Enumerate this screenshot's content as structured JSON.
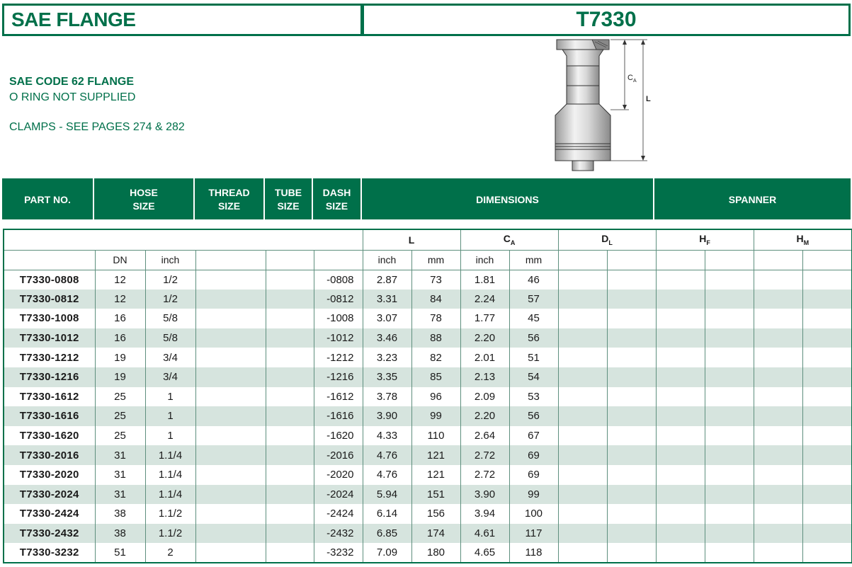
{
  "header": {
    "left_title": "SAE FLANGE",
    "right_title": "T7330"
  },
  "description": {
    "line1": "SAE CODE 62 FLANGE",
    "line2": "O RING NOT SUPPLIED",
    "line3": "CLAMPS - SEE PAGES 274 & 282"
  },
  "drawing": {
    "label_ca_main": "C",
    "label_ca_sub": "A",
    "label_l": "L"
  },
  "band": {
    "part_no": "PART NO.",
    "hose_size_1": "HOSE",
    "hose_size_2": "SIZE",
    "thread_size_1": "THREAD",
    "thread_size_2": "SIZE",
    "tube_size_1": "TUBE",
    "tube_size_2": "SIZE",
    "dash_size_1": "DASH",
    "dash_size_2": "SIZE",
    "dimensions": "DIMENSIONS",
    "spanner": "SPANNER"
  },
  "subheaders": {
    "l": "L",
    "ca_main": "C",
    "ca_sub": "A",
    "dl_main": "D",
    "dl_sub": "L",
    "hf_main": "H",
    "hf_sub": "F",
    "hm_main": "H",
    "hm_sub": "M",
    "dn": "DN",
    "inch": "inch",
    "mm": "mm"
  },
  "rows": [
    {
      "part": "T7330-0808",
      "dn": "12",
      "inch": "1/2",
      "dash": "-0808",
      "l_in": "2.87",
      "l_mm": "73",
      "ca_in": "1.81",
      "ca_mm": "46"
    },
    {
      "part": "T7330-0812",
      "dn": "12",
      "inch": "1/2",
      "dash": "-0812",
      "l_in": "3.31",
      "l_mm": "84",
      "ca_in": "2.24",
      "ca_mm": "57"
    },
    {
      "part": "T7330-1008",
      "dn": "16",
      "inch": "5/8",
      "dash": "-1008",
      "l_in": "3.07",
      "l_mm": "78",
      "ca_in": "1.77",
      "ca_mm": "45"
    },
    {
      "part": "T7330-1012",
      "dn": "16",
      "inch": "5/8",
      "dash": "-1012",
      "l_in": "3.46",
      "l_mm": "88",
      "ca_in": "2.20",
      "ca_mm": "56"
    },
    {
      "part": "T7330-1212",
      "dn": "19",
      "inch": "3/4",
      "dash": "-1212",
      "l_in": "3.23",
      "l_mm": "82",
      "ca_in": "2.01",
      "ca_mm": "51"
    },
    {
      "part": "T7330-1216",
      "dn": "19",
      "inch": "3/4",
      "dash": "-1216",
      "l_in": "3.35",
      "l_mm": "85",
      "ca_in": "2.13",
      "ca_mm": "54"
    },
    {
      "part": "T7330-1612",
      "dn": "25",
      "inch": "1",
      "dash": "-1612",
      "l_in": "3.78",
      "l_mm": "96",
      "ca_in": "2.09",
      "ca_mm": "53"
    },
    {
      "part": "T7330-1616",
      "dn": "25",
      "inch": "1",
      "dash": "-1616",
      "l_in": "3.90",
      "l_mm": "99",
      "ca_in": "2.20",
      "ca_mm": "56"
    },
    {
      "part": "T7330-1620",
      "dn": "25",
      "inch": "1",
      "dash": "-1620",
      "l_in": "4.33",
      "l_mm": "110",
      "ca_in": "2.64",
      "ca_mm": "67"
    },
    {
      "part": "T7330-2016",
      "dn": "31",
      "inch": "1.1/4",
      "dash": "-2016",
      "l_in": "4.76",
      "l_mm": "121",
      "ca_in": "2.72",
      "ca_mm": "69"
    },
    {
      "part": "T7330-2020",
      "dn": "31",
      "inch": "1.1/4",
      "dash": "-2020",
      "l_in": "4.76",
      "l_mm": "121",
      "ca_in": "2.72",
      "ca_mm": "69"
    },
    {
      "part": "T7330-2024",
      "dn": "31",
      "inch": "1.1/4",
      "dash": "-2024",
      "l_in": "5.94",
      "l_mm": "151",
      "ca_in": "3.90",
      "ca_mm": "99"
    },
    {
      "part": "T7330-2424",
      "dn": "38",
      "inch": "1.1/2",
      "dash": "-2424",
      "l_in": "6.14",
      "l_mm": "156",
      "ca_in": "3.94",
      "ca_mm": "100"
    },
    {
      "part": "T7330-2432",
      "dn": "38",
      "inch": "1.1/2",
      "dash": "-2432",
      "l_in": "6.85",
      "l_mm": "174",
      "ca_in": "4.61",
      "ca_mm": "117"
    },
    {
      "part": "T7330-3232",
      "dn": "51",
      "inch": "2",
      "dash": "-3232",
      "l_in": "7.09",
      "l_mm": "180",
      "ca_in": "4.65",
      "ca_mm": "118"
    }
  ],
  "colors": {
    "brand_green": "#00704a",
    "row_stripe": "#d6e4de"
  }
}
